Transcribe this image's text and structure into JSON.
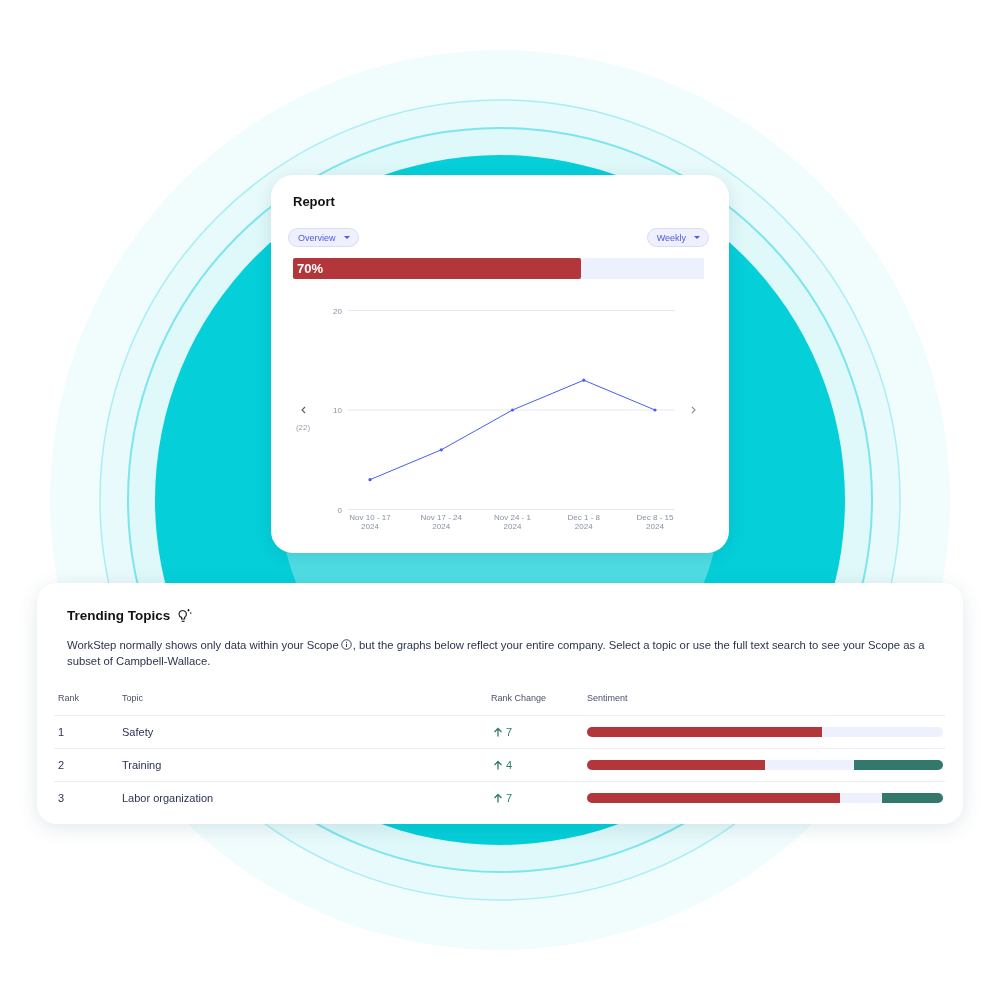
{
  "report": {
    "title": "Report",
    "filters": [
      {
        "label": "Overview"
      },
      {
        "label": "Weekly"
      }
    ],
    "progress": {
      "label": "70%",
      "level": 0.7
    },
    "pager": {
      "count": "(22)"
    },
    "chart_data": {
      "type": "line",
      "categories": [
        "Nov 10 - 17\n2024",
        "Nov 17 - 24\n2024",
        "Nov 24 - 1\n2024",
        "Dec 1 - 8\n2024",
        "Dec 8 - 15\n2024"
      ],
      "values": [
        3,
        6,
        10,
        13,
        10
      ],
      "ylim": [
        0,
        20
      ],
      "yticks": [
        0,
        10,
        20
      ]
    }
  },
  "trending_topics": {
    "title": "Trending Topics",
    "description": {
      "before": "WorkStep normally shows only data within your Scope",
      "after": ", but the graphs below reflect your entire company. Select a topic or use the full text search to see your Scope as a subset of Campbell-Wallace."
    },
    "columns": [
      "Rank",
      "Topic",
      "Rank Change",
      "Sentiment"
    ],
    "rows": [
      {
        "rank": "1",
        "topic": "Safety",
        "rank_change": {
          "increase": true,
          "value": "7"
        },
        "sentiment": [
          {
            "kind": "negative",
            "level": 0.66
          }
        ]
      },
      {
        "rank": "2",
        "topic": "Training",
        "rank_change": {
          "increase": true,
          "value": "4"
        },
        "sentiment": [
          {
            "kind": "negative",
            "level": 0.5
          },
          {
            "kind": "positive",
            "level": 0.25
          }
        ]
      },
      {
        "rank": "3",
        "topic": "Labor organization",
        "rank_change": {
          "increase": true,
          "value": "7"
        },
        "sentiment": [
          {
            "kind": "negative",
            "level": 0.71
          },
          {
            "kind": "positive",
            "level": 0.17
          }
        ]
      }
    ]
  }
}
